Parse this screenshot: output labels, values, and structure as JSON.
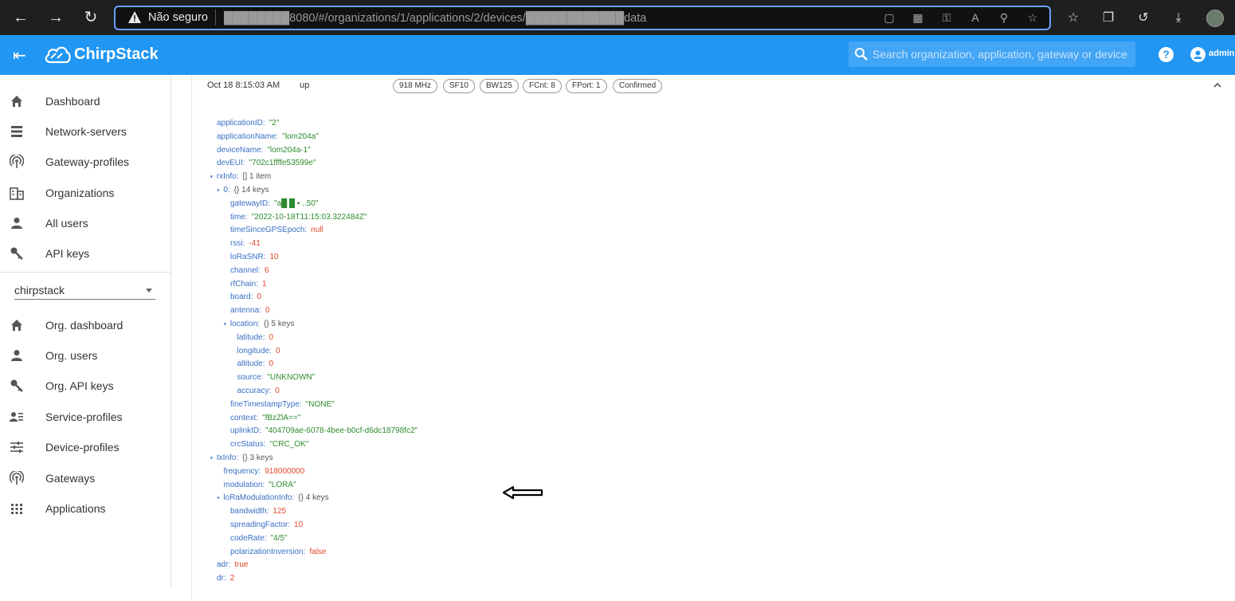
{
  "browser": {
    "insecure_label": "Não seguro",
    "url": "████████8080/#/organizations/1/applications/2/devices/████████████data"
  },
  "app": {
    "title": "ChirpStack",
    "search_placeholder": "Search organization, application, gateway or device",
    "user": "admin"
  },
  "sidebar": {
    "items": [
      {
        "label": "Dashboard",
        "icon": "home-icon"
      },
      {
        "label": "Network-servers",
        "icon": "server-icon"
      },
      {
        "label": "Gateway-profiles",
        "icon": "radio-tower-icon"
      },
      {
        "label": "Organizations",
        "icon": "domain-icon"
      },
      {
        "label": "All users",
        "icon": "account-icon"
      },
      {
        "label": "API keys",
        "icon": "key-icon"
      }
    ],
    "org_select": "chirpstack",
    "org_items": [
      {
        "label": "Org. dashboard",
        "icon": "home-icon"
      },
      {
        "label": "Org. users",
        "icon": "account-icon"
      },
      {
        "label": "Org. API keys",
        "icon": "key-icon"
      },
      {
        "label": "Service-profiles",
        "icon": "account-details-icon"
      },
      {
        "label": "Device-profiles",
        "icon": "tune-icon"
      },
      {
        "label": "Gateways",
        "icon": "radio-tower-icon"
      },
      {
        "label": "Applications",
        "icon": "apps-icon"
      }
    ]
  },
  "event": {
    "time": "Oct 18 8:15:03 AM",
    "type": "up",
    "chips": [
      "918 MHz",
      "SF10",
      "BW125",
      "FCnt: 8",
      "FPort: 1",
      "Confirmed"
    ]
  },
  "tree": [
    {
      "d": 0,
      "k": "applicationID",
      "v": "\"2\"",
      "t": "s"
    },
    {
      "d": 0,
      "k": "applicationName",
      "v": "\"lom204a\"",
      "t": "s"
    },
    {
      "d": 0,
      "k": "deviceName",
      "v": "\"lom204a-1\"",
      "t": "s"
    },
    {
      "d": 0,
      "k": "devEUI",
      "v": "\"702c1ffffe53599e\"",
      "t": "s"
    },
    {
      "d": 0,
      "k": "rxInfo",
      "v": "[] 1 item",
      "t": "meta",
      "toggle": true
    },
    {
      "d": 1,
      "k": "0",
      "v": "{} 14 keys",
      "t": "meta",
      "toggle": true
    },
    {
      "d": 2,
      "k": "gatewayID",
      "v": "\"a█      █   ▪ ..50\"",
      "t": "s"
    },
    {
      "d": 2,
      "k": "time",
      "v": "\"2022-10-18T11:15:03.322484Z\"",
      "t": "s"
    },
    {
      "d": 2,
      "k": "timeSinceGPSEpoch",
      "v": "null",
      "t": "n"
    },
    {
      "d": 2,
      "k": "rssi",
      "v": "-41",
      "t": "n"
    },
    {
      "d": 2,
      "k": "loRaSNR",
      "v": "10",
      "t": "n"
    },
    {
      "d": 2,
      "k": "channel",
      "v": "6",
      "t": "n"
    },
    {
      "d": 2,
      "k": "rfChain",
      "v": "1",
      "t": "n"
    },
    {
      "d": 2,
      "k": "board",
      "v": "0",
      "t": "n"
    },
    {
      "d": 2,
      "k": "antenna",
      "v": "0",
      "t": "n"
    },
    {
      "d": 2,
      "k": "location",
      "v": "{} 5 keys",
      "t": "meta",
      "toggle": true
    },
    {
      "d": 3,
      "k": "latitude",
      "v": "0",
      "t": "n"
    },
    {
      "d": 3,
      "k": "longitude",
      "v": "0",
      "t": "n"
    },
    {
      "d": 3,
      "k": "altitude",
      "v": "0",
      "t": "n"
    },
    {
      "d": 3,
      "k": "source",
      "v": "\"UNKNOWN\"",
      "t": "s"
    },
    {
      "d": 3,
      "k": "accuracy",
      "v": "0",
      "t": "n"
    },
    {
      "d": 2,
      "k": "fineTimestampType",
      "v": "\"NONE\"",
      "t": "s"
    },
    {
      "d": 2,
      "k": "context",
      "v": "\"fBzZlA==\"",
      "t": "s"
    },
    {
      "d": 2,
      "k": "uplinkID",
      "v": "\"404709ae-6078-4bee-b0cf-d6dc18798fc2\"",
      "t": "s"
    },
    {
      "d": 2,
      "k": "crcStatus",
      "v": "\"CRC_OK\"",
      "t": "s"
    },
    {
      "d": 0,
      "k": "txInfo",
      "v": "{} 3 keys",
      "t": "meta",
      "toggle": true
    },
    {
      "d": 1,
      "k": "frequency",
      "v": "918000000",
      "t": "n"
    },
    {
      "d": 1,
      "k": "modulation",
      "v": "\"LORA\"",
      "t": "s"
    },
    {
      "d": 1,
      "k": "loRaModulationInfo",
      "v": "{} 4 keys",
      "t": "meta",
      "toggle": true
    },
    {
      "d": 2,
      "k": "bandwidth",
      "v": "125",
      "t": "n"
    },
    {
      "d": 2,
      "k": "spreadingFactor",
      "v": "10",
      "t": "n"
    },
    {
      "d": 2,
      "k": "codeRate",
      "v": "\"4/5\"",
      "t": "s"
    },
    {
      "d": 2,
      "k": "polarizationInversion",
      "v": "false",
      "t": "n"
    },
    {
      "d": 0,
      "k": "adr",
      "v": "true",
      "t": "n"
    },
    {
      "d": 0,
      "k": "dr",
      "v": "2",
      "t": "n"
    }
  ],
  "colors": {
    "primary": "#2196f3",
    "chrome": "#1f1f1f",
    "key": "#3a6fc4",
    "string": "#2e8b2e",
    "number": "#e04a2a"
  }
}
